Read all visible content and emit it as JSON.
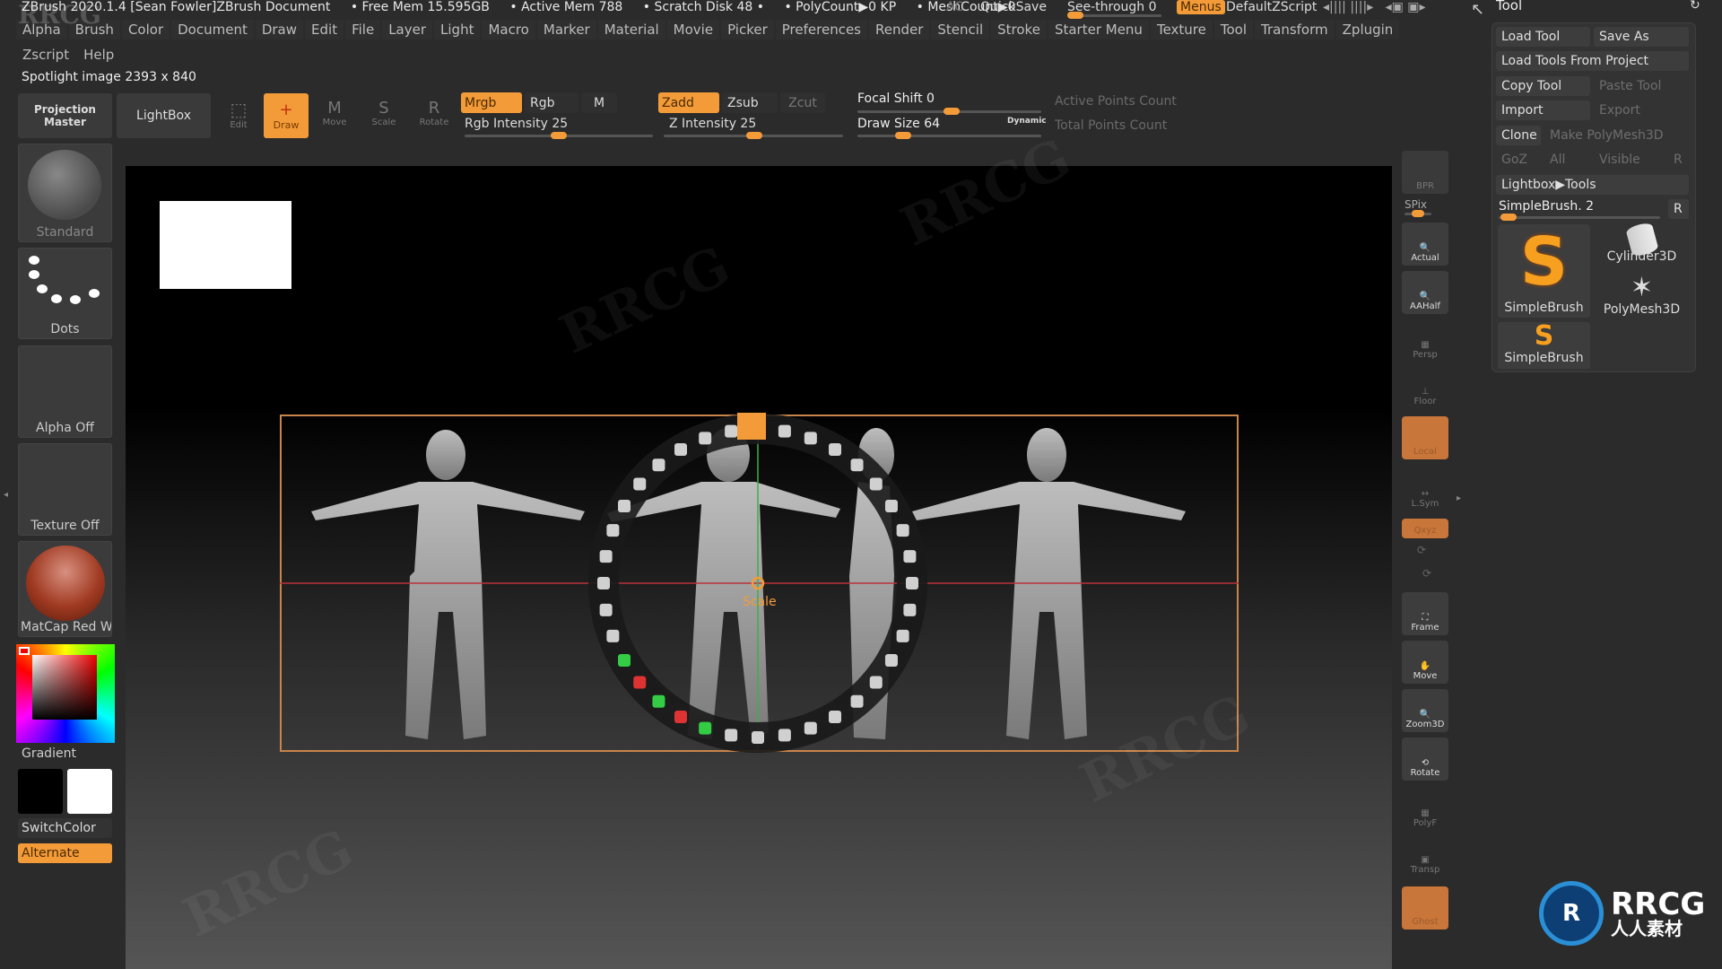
{
  "titlebar": {
    "app": "ZBrush 2020.1.4 [Sean Fowler]ZBrush Document",
    "free_mem": "• Free Mem 15.595GB",
    "active_mem": "• Active Mem 788",
    "scratch": "• Scratch Disk 48 •",
    "polycount": "• PolyCount▶0 KP",
    "meshcount": "• MeshCount▶0",
    "ac": "AC",
    "quicksave": "QuickSave",
    "see_through": "See-through  0",
    "see_through_value": 0,
    "menus": "Menus",
    "script": "DefaultZScript"
  },
  "menu": {
    "items": [
      "Alpha",
      "Brush",
      "Color",
      "Document",
      "Draw",
      "Edit",
      "File",
      "Layer",
      "Light",
      "Macro",
      "Marker",
      "Material",
      "Movie",
      "Picker",
      "Preferences",
      "Render",
      "Stencil",
      "Stroke",
      "Starter Menu",
      "Texture",
      "Tool",
      "Transform",
      "Zplugin"
    ],
    "row2": [
      "Zscript",
      "Help"
    ]
  },
  "status": "Spotlight image 2393 x 840",
  "toolbar": {
    "projection_master": "Projection Master",
    "lightbox": "LightBox",
    "edit": "Edit",
    "draw": "Draw",
    "move": "Move",
    "scale": "Scale",
    "rotate": "Rotate",
    "mrgb": "Mrgb",
    "rgb": "Rgb",
    "m": "M",
    "rgb_intensity": "Rgb Intensity 25",
    "rgb_intensity_value": 25,
    "zadd": "Zadd",
    "zsub": "Zsub",
    "zcut": "Zcut",
    "z_intensity": "Z Intensity 25",
    "z_intensity_value": 25,
    "focal_shift": "Focal Shift 0",
    "focal_shift_value": 0,
    "draw_size": "Draw Size 64",
    "draw_size_value": 64,
    "dynamic": "Dynamic",
    "active_points": "Active Points Count",
    "total_points": "Total Points Count"
  },
  "left_shelf": {
    "brush": "Standard",
    "stroke": "Dots",
    "alpha": "Alpha Off",
    "texture": "Texture Off",
    "material": "MatCap Red Wa",
    "gradient": "Gradient",
    "switch_color": "SwitchColor",
    "alternate": "Alternate"
  },
  "viewport": {
    "spotlight_label": "Scale",
    "colors": {
      "accent": "#f39b38",
      "frame": "#c9844a"
    }
  },
  "right_shelf": {
    "bpr": "BPR",
    "spix": "SPix",
    "actual": "Actual",
    "aahalf": "AAHalf",
    "persp": "Persp",
    "floor": "Floor",
    "local": "Local",
    "lsym": "L.Sym",
    "xyz": "Qxyz",
    "frame": "Frame",
    "move": "Move",
    "zoom3d": "Zoom3D",
    "rotate": "Rotate",
    "polyf": "PolyF",
    "transp": "Transp",
    "ghost": "Ghost"
  },
  "tool_panel": {
    "title": "Tool",
    "load_tool": "Load Tool",
    "save_as": "Save As",
    "load_from_project": "Load Tools From Project",
    "copy_tool": "Copy Tool",
    "paste_tool": "Paste Tool",
    "import": "Import",
    "export": "Export",
    "clone": "Clone",
    "make_polymesh": "Make PolyMesh3D",
    "goz": "GoZ",
    "all": "All",
    "visible": "Visible",
    "r": "R",
    "lightbox_tools": "Lightbox▶Tools",
    "current_tool": "SimpleBrush. 2",
    "tools": [
      "SimpleBrush",
      "Cylinder3D",
      "PolyMesh3D",
      "SimpleBrush"
    ]
  },
  "watermark": {
    "logo": "RRCG",
    "sub": "人人素材"
  }
}
